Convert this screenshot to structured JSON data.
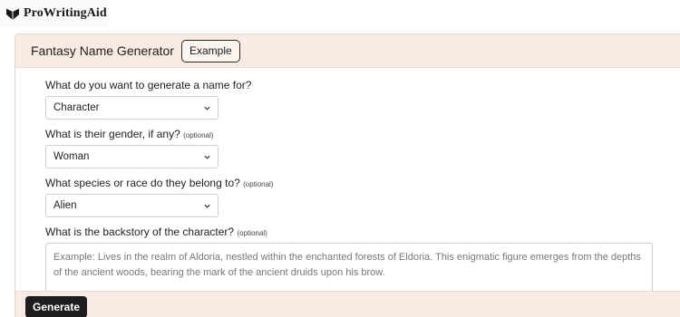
{
  "brand": {
    "logo_icon": "heart-book-icon",
    "name": "ProWritingAid"
  },
  "generator": {
    "title": "Fantasy Name Generator",
    "example_label": "Example",
    "generate_label": "Generate",
    "optional_tag": "(optional)",
    "fields": {
      "type": {
        "label": "What do you want to generate a name for?",
        "value": "Character"
      },
      "gender": {
        "label": "What is their gender, if any?",
        "value": "Woman"
      },
      "species": {
        "label": "What species or race do they belong to?",
        "value": "Alien"
      },
      "backstory": {
        "label": "What is the backstory of the character?",
        "placeholder": "Example: Lives in the realm of Aldoria, nestled within the enchanted forests of Eldoria. This enigmatic figure emerges from the depths of the ancient woods, bearing the mark of the ancient druids upon his brow."
      }
    }
  },
  "colors": {
    "panel_bg": "#f8ebe3",
    "button_dark": "#1e1e1e"
  }
}
